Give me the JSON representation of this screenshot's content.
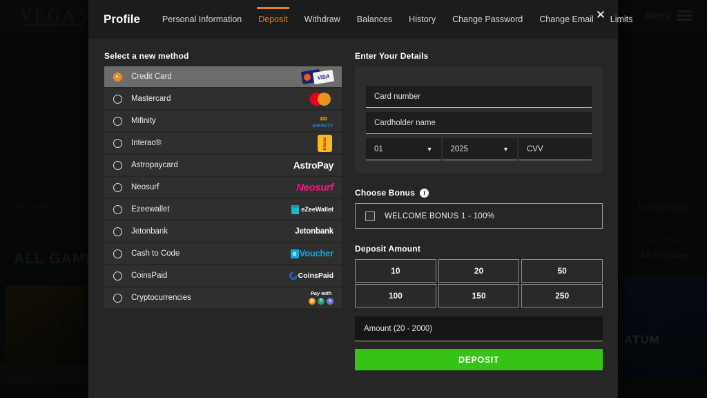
{
  "background": {
    "logo": "VEGAS",
    "menu_label": "Menu",
    "all_games_label": "ALL GAMES",
    "bonus_buys_label": "Bonus buys",
    "select_provider_label": "Select Provider",
    "all_providers_label": "All Providers",
    "ai_label": "AI Content",
    "tile_right_word": "ATUM"
  },
  "modal": {
    "title": "Profile",
    "close_label": "✕",
    "tabs": [
      {
        "label": "Personal Information",
        "active": false
      },
      {
        "label": "Deposit",
        "active": true
      },
      {
        "label": "Withdraw",
        "active": false
      },
      {
        "label": "Balances",
        "active": false
      },
      {
        "label": "History",
        "active": false
      },
      {
        "label": "Change Password",
        "active": false
      },
      {
        "label": "Change Email",
        "active": false
      },
      {
        "label": "Limits",
        "active": false
      }
    ],
    "left": {
      "heading": "Select a new method",
      "methods": [
        {
          "label": "Credit Card",
          "selected": true,
          "logo": "visa-mastercard-logo"
        },
        {
          "label": "Mastercard",
          "selected": false,
          "logo": "mastercard-logo"
        },
        {
          "label": "Mifinity",
          "selected": false,
          "logo": "mifinity-logo"
        },
        {
          "label": "Interac®",
          "selected": false,
          "logo": "interac-logo"
        },
        {
          "label": "Astropaycard",
          "selected": false,
          "logo": "astropay-logo"
        },
        {
          "label": "Neosurf",
          "selected": false,
          "logo": "neosurf-logo"
        },
        {
          "label": "Ezeewallet",
          "selected": false,
          "logo": "ezeewallet-logo"
        },
        {
          "label": "Jetonbank",
          "selected": false,
          "logo": "jetonbank-logo"
        },
        {
          "label": "Cash to Code",
          "selected": false,
          "logo": "evoucher-logo"
        },
        {
          "label": "CoinsPaid",
          "selected": false,
          "logo": "coinspaid-logo"
        },
        {
          "label": "Cryptocurrencies",
          "selected": false,
          "logo": "crypto-logo"
        }
      ],
      "logo_text": {
        "visa": "VISA",
        "mifinity": "MIFINITY",
        "interac": "interac",
        "astropay": "AstroPay",
        "neosurf": "Neosurf",
        "ezeewallet": "eZeeWallet",
        "jetonbank": "Jetonbank",
        "evoucher_e": "e",
        "evoucher_t": "Voucher",
        "coinspaid": "CoinsPaid",
        "crypto_pay_with": "Pay with",
        "crypto_btc": "₿",
        "crypto_usdt": "T",
        "crypto_eth": "♦"
      }
    },
    "right": {
      "heading": "Enter Your Details",
      "card_number_placeholder": "Card number",
      "cardholder_placeholder": "Cardholder name",
      "exp_month_value": "01",
      "exp_year_value": "2025",
      "cvv_placeholder": "CVV",
      "chevron": "⌄",
      "bonus_heading": "Choose Bonus",
      "info_icon_glyph": "i",
      "bonus_option": "WELCOME BONUS 1 - 100%",
      "bonus_checked": false,
      "deposit_amount_heading": "Deposit Amount",
      "amount_presets": [
        "10",
        "20",
        "50",
        "100",
        "150",
        "250"
      ],
      "amount_placeholder": "Amount (20 - 2000)",
      "deposit_button": "DEPOSIT"
    }
  },
  "colors": {
    "accent": "#e8821e",
    "radio_selected": "#f08a20",
    "deposit_green": "#35c415",
    "modal_bg": "#262626",
    "row_bg": "#2f2f2f",
    "row_selected_bg": "#6c6c6c"
  }
}
